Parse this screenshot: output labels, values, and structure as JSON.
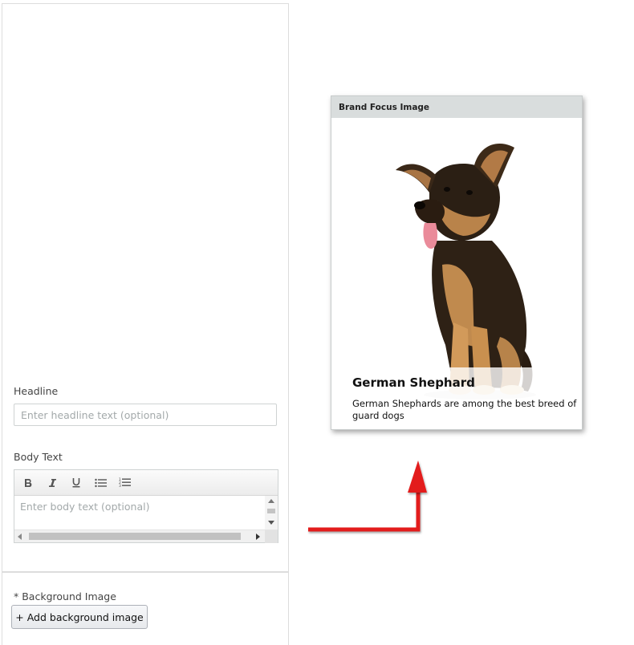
{
  "form": {
    "headline_label": "Headline",
    "headline_placeholder": "Enter headline text (optional)",
    "headline_value": "",
    "body_label": "Body Text",
    "body_placeholder": "Enter body text (optional)",
    "body_value": "",
    "toolbar": {
      "bold_icon": "bold-icon",
      "italic_icon": "italic-icon",
      "underline_icon": "underline-icon",
      "bullet_list_icon": "bullet-list-icon",
      "numbered_list_icon": "numbered-list-icon"
    },
    "background_label": "* Background Image",
    "background_button_label": "+ Add background image"
  },
  "preview": {
    "header": "Brand Focus Image",
    "image_icon": "german-shepherd-puppy-photo",
    "headline": "German Shephard",
    "body": "German Shephards are among the best breed of guard dogs"
  },
  "annotation": {
    "arrow_icon": "red-arrow-icon",
    "color": "#e31b1b"
  },
  "colors": {
    "border": "#dddddd",
    "header_bg": "#d9dddd",
    "placeholder": "#a3a9aa"
  }
}
